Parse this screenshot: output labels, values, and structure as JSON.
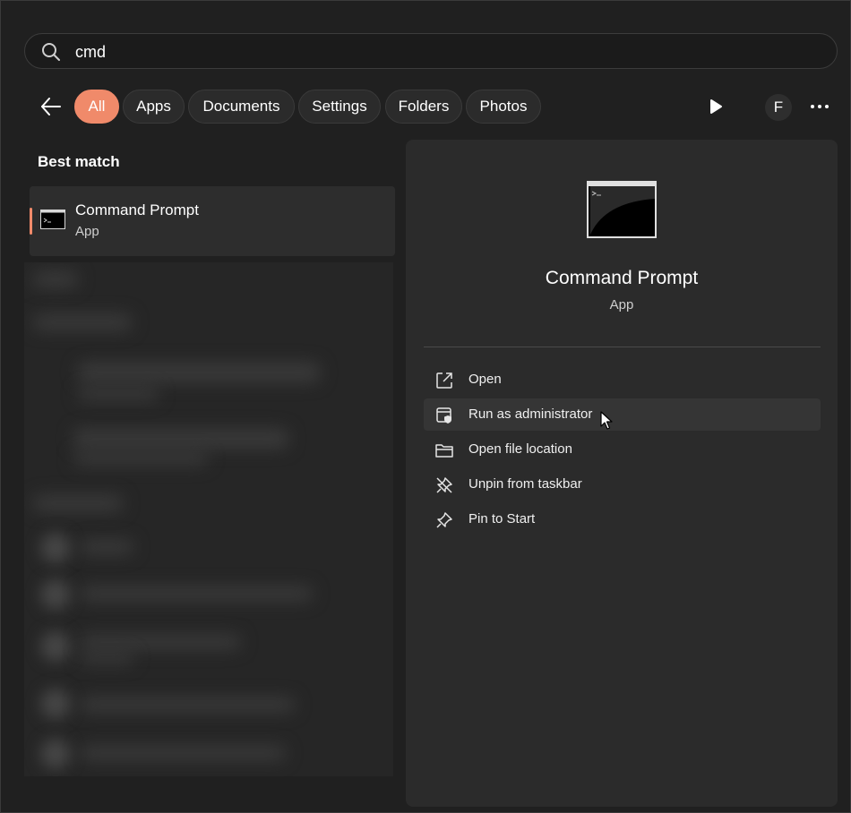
{
  "search": {
    "query": "cmd"
  },
  "filters": [
    "All",
    "Apps",
    "Documents",
    "Settings",
    "Folders",
    "Photos"
  ],
  "account": {
    "initial": "F"
  },
  "best_match": {
    "heading": "Best match",
    "title": "Command Prompt",
    "subtitle": "App"
  },
  "detail": {
    "title": "Command Prompt",
    "subtitle": "App",
    "actions": [
      "Open",
      "Run as administrator",
      "Open file location",
      "Unpin from taskbar",
      "Pin to Start"
    ]
  },
  "colors": {
    "accent": "#f08a6a",
    "background": "#202020",
    "pane": "#2b2b2b"
  },
  "icons": {
    "search": "search-icon",
    "back": "back-arrow-icon",
    "play": "play-icon",
    "more": "more-icon",
    "actions": [
      "open-external-icon",
      "shield-admin-icon",
      "folder-icon",
      "unpin-icon",
      "pin-icon"
    ]
  }
}
